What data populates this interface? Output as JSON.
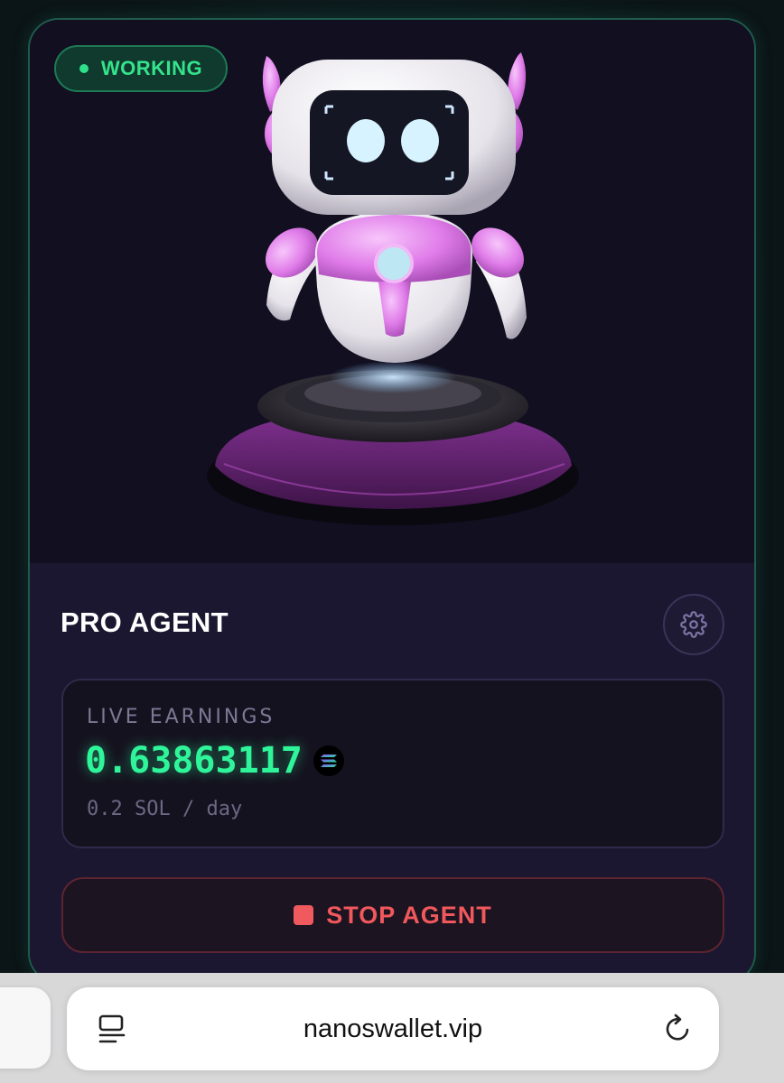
{
  "card": {
    "status_badge": "WORKING",
    "agent_name": "PRO AGENT",
    "settings_icon": "gear-icon",
    "earnings": {
      "label": "LIVE EARNINGS",
      "value": "0.63863117",
      "currency_icon": "solana-icon",
      "rate": "0.2 SOL / day"
    },
    "stop_button": {
      "icon": "stop-square-icon",
      "label": "STOP AGENT"
    }
  },
  "browser": {
    "url": "nanoswallet.vip",
    "left_icon": "reader-mode-icon",
    "right_icon": "reload-icon"
  },
  "colors": {
    "accent_green": "#2ff59a",
    "stop_red": "#f0585c",
    "card_bg": "#1b1730",
    "robot_pink": "#e58bf0"
  }
}
